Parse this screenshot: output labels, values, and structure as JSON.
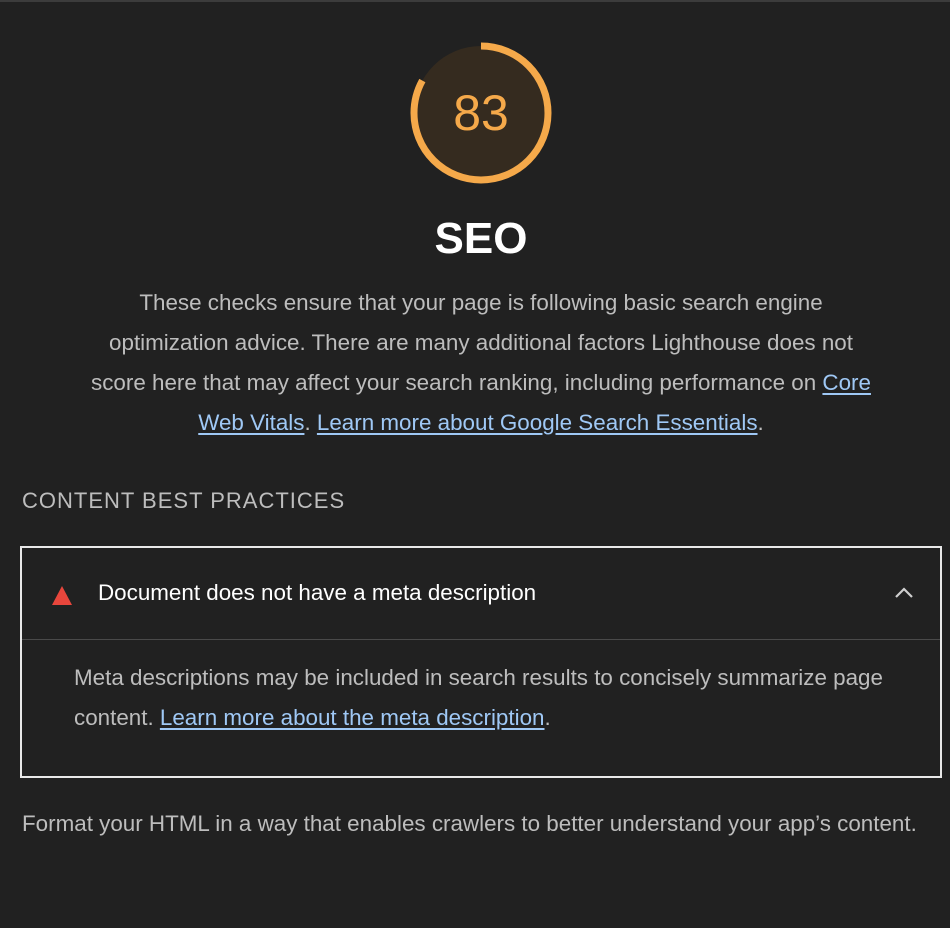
{
  "category": {
    "score": "83",
    "score_fraction": 0.83,
    "score_color": "#f5a94a",
    "title": "SEO",
    "description_text": "These checks ensure that your page is following basic search engine optimization advice. There are many additional factors Lighthouse does not score here that may affect your search ranking, including performance on ",
    "link_core_web_vitals": "Core Web Vitals",
    "separator": ". ",
    "link_search_essentials": "Learn more about Google Search Essentials",
    "description_end": "."
  },
  "group": {
    "header": "CONTENT BEST PRACTICES",
    "description": "Format your HTML in a way that enables crawlers to better understand your app’s content."
  },
  "audit": {
    "title": "Document does not have a meta description",
    "status_icon": "fail-triangle-icon",
    "status_color": "#e8463c",
    "expanded": true,
    "body_text": "Meta descriptions may be included in search results to concisely summarize page content. ",
    "body_link": "Learn more about the meta description",
    "body_end": "."
  }
}
